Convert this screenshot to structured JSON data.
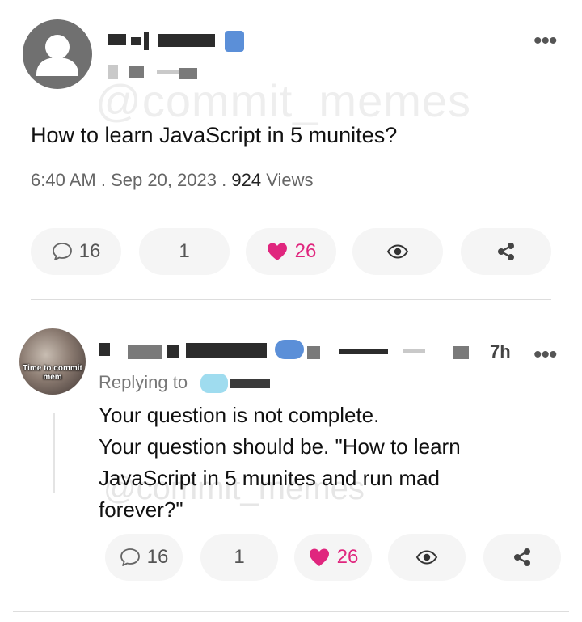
{
  "watermark": {
    "top": "@commit_memes",
    "bottom": "@commit_memes"
  },
  "post": {
    "text": "How to learn JavaScript in 5 munites?",
    "time": "6:40 AM",
    "date": "Sep 20, 2023",
    "views_count": "924",
    "views_label": "Views",
    "separator": ".",
    "actions": {
      "comments": "16",
      "reposts": "1",
      "likes": "26"
    }
  },
  "reply": {
    "avatar_caption": "Time to commit mem",
    "time": "7h",
    "replying_label": "Replying to",
    "text_lines": [
      "Your question is not complete.",
      "Your question should be. \"How to learn",
      "JavaScript in 5 munites and run mad",
      "forever?\""
    ],
    "actions": {
      "comments": "16",
      "reposts": "1",
      "likes": "26"
    }
  },
  "icons": {
    "comment": "speech-bubble-outline",
    "like": "heart-filled",
    "views": "eye",
    "share": "share-nodes",
    "more": "three-dots-horizontal"
  },
  "colors": {
    "like": "#e0267e",
    "pill_bg": "#f5f5f5",
    "meta_text": "#666666"
  }
}
